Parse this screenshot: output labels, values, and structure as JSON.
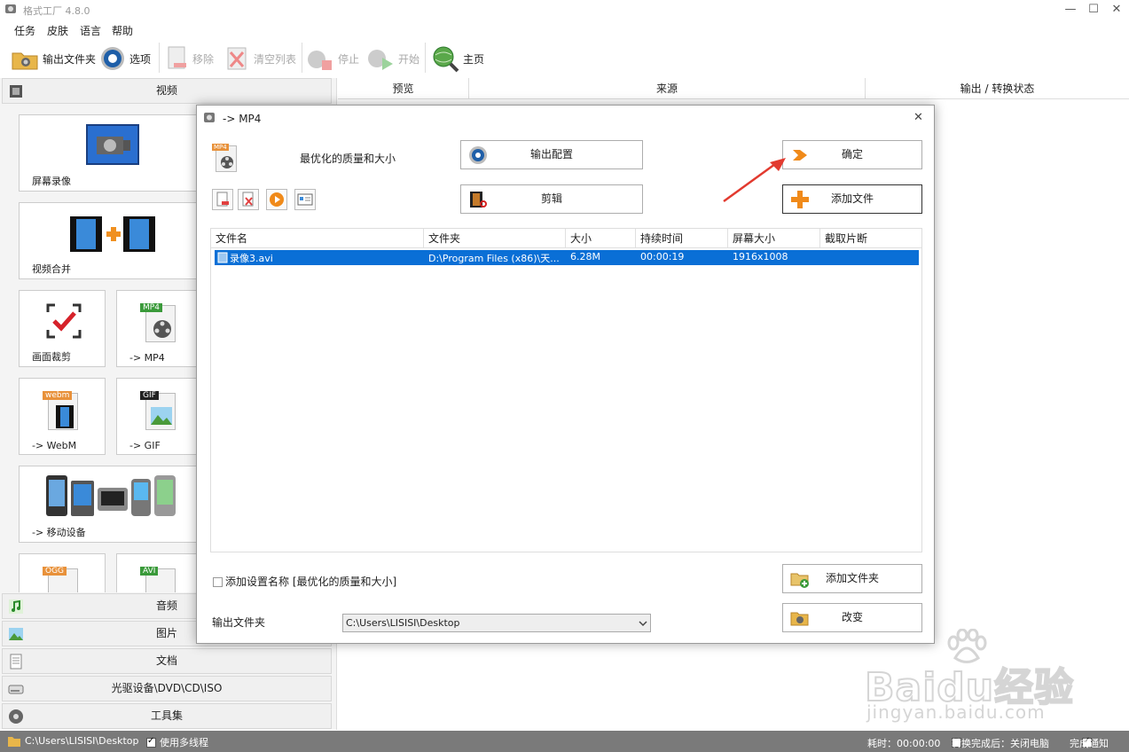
{
  "window": {
    "title": "格式工厂 4.8.0",
    "controls": [
      "—",
      "☐",
      "✕"
    ]
  },
  "menu": [
    "任务",
    "皮肤",
    "语言",
    "帮助"
  ],
  "toolbar": {
    "output_folder": "输出文件夹",
    "options": "选项",
    "remove": "移除",
    "clear_list": "清空列表",
    "stop": "停止",
    "start": "开始",
    "home": "主页"
  },
  "sidebar": {
    "video_header": "视频",
    "tiles": [
      "屏幕录像",
      "视频合并",
      "画面裁剪",
      "-> MP4",
      "-> WebM",
      "-> GIF",
      "-> 移动设备"
    ],
    "tile_badges": {
      "mp4": "MP4",
      "webm": "webm",
      "gif": "GIF",
      "ogg": "OGG",
      "avi": "AVI"
    },
    "categories": [
      "音频",
      "图片",
      "文档",
      "光驱设备\\DVD\\CD\\ISO",
      "工具集"
    ]
  },
  "task_columns": [
    "预览",
    "来源",
    "输出 / 转换状态"
  ],
  "dialog": {
    "title": "-> MP4",
    "close": "✕",
    "badge": "MP4",
    "preset": "最优化的质量和大小",
    "output_config": "输出配置",
    "clip": "剪辑",
    "ok": "确定",
    "add_file": "添加文件",
    "add_folder": "添加文件夹",
    "change": "改变",
    "file_columns": [
      "文件名",
      "文件夹",
      "大小",
      "持续时间",
      "屏幕大小",
      "截取片断"
    ],
    "files": [
      {
        "name": "录像3.avi",
        "folder": "D:\\Program Files (x86)\\天...",
        "size": "6.28M",
        "duration": "00:00:19",
        "screen": "1916x1008",
        "clip": ""
      }
    ],
    "add_setting_name": "添加设置名称 [最优化的质量和大小]",
    "output_folder_label": "输出文件夹",
    "output_folder_value": "C:\\Users\\LISISI\\Desktop"
  },
  "statusbar": {
    "path": "C:\\Users\\LISISI\\Desktop",
    "multithread": "使用多线程",
    "elapsed": "耗时：00:00:00",
    "after_done": "转换完成后：关闭电脑",
    "notify": "完成通知"
  },
  "watermark": {
    "brand": "Baidu经验",
    "url": "jingyan.baidu.com"
  },
  "colors": {
    "accent": "#0a6fd6",
    "arrow": "#e23a2f",
    "statusbar": "#7a7a7a"
  }
}
